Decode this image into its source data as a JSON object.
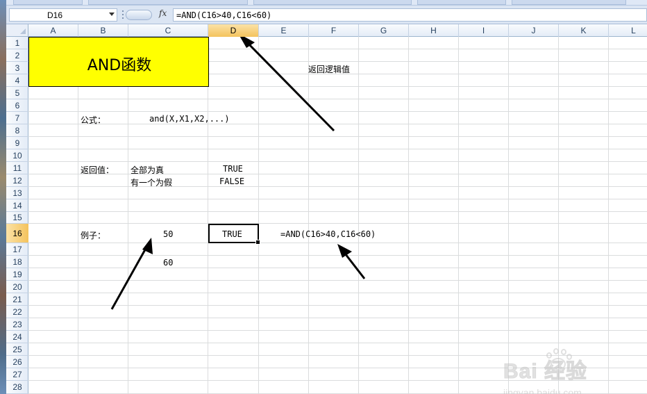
{
  "formula_bar": {
    "name_box": "D16",
    "fx_icon": "fx-icon",
    "formula": "=AND(C16>40,C16<60)"
  },
  "columns": [
    "A",
    "B",
    "C",
    "D",
    "E",
    "F",
    "G",
    "H",
    "I",
    "J",
    "K",
    "L"
  ],
  "active_column": "D",
  "rows": [
    "1",
    "2",
    "3",
    "4",
    "5",
    "6",
    "7",
    "8",
    "9",
    "10",
    "11",
    "12",
    "13",
    "14",
    "15",
    "16",
    "17",
    "18",
    "19",
    "20",
    "21",
    "22",
    "23",
    "24",
    "25",
    "26",
    "27",
    "28"
  ],
  "active_row": "16",
  "sheet": {
    "title": "AND函数",
    "return_note": "返回逻辑值",
    "formula_label": "公式：",
    "formula_syntax": "and(X,X1,X2,...)",
    "return_label": "返回值：",
    "all_true": "全部为真",
    "true_value": "TRUE",
    "one_false": "有一个为假",
    "false_value": "FALSE",
    "example_label": "例子：",
    "c16": "50",
    "d16": "TRUE",
    "e16": "=AND(C16>40,C16<60)",
    "c18": "60"
  },
  "annotations": {
    "arrow_color": "#000000"
  },
  "watermark": {
    "brand": "Bai  经验",
    "site": "jingyan.baidu.com"
  },
  "colors": {
    "title_fill": "#ffff00",
    "active_header": "#f4c35d",
    "header_bg": "#e4ecf7",
    "gridline": "#dadcdd"
  }
}
